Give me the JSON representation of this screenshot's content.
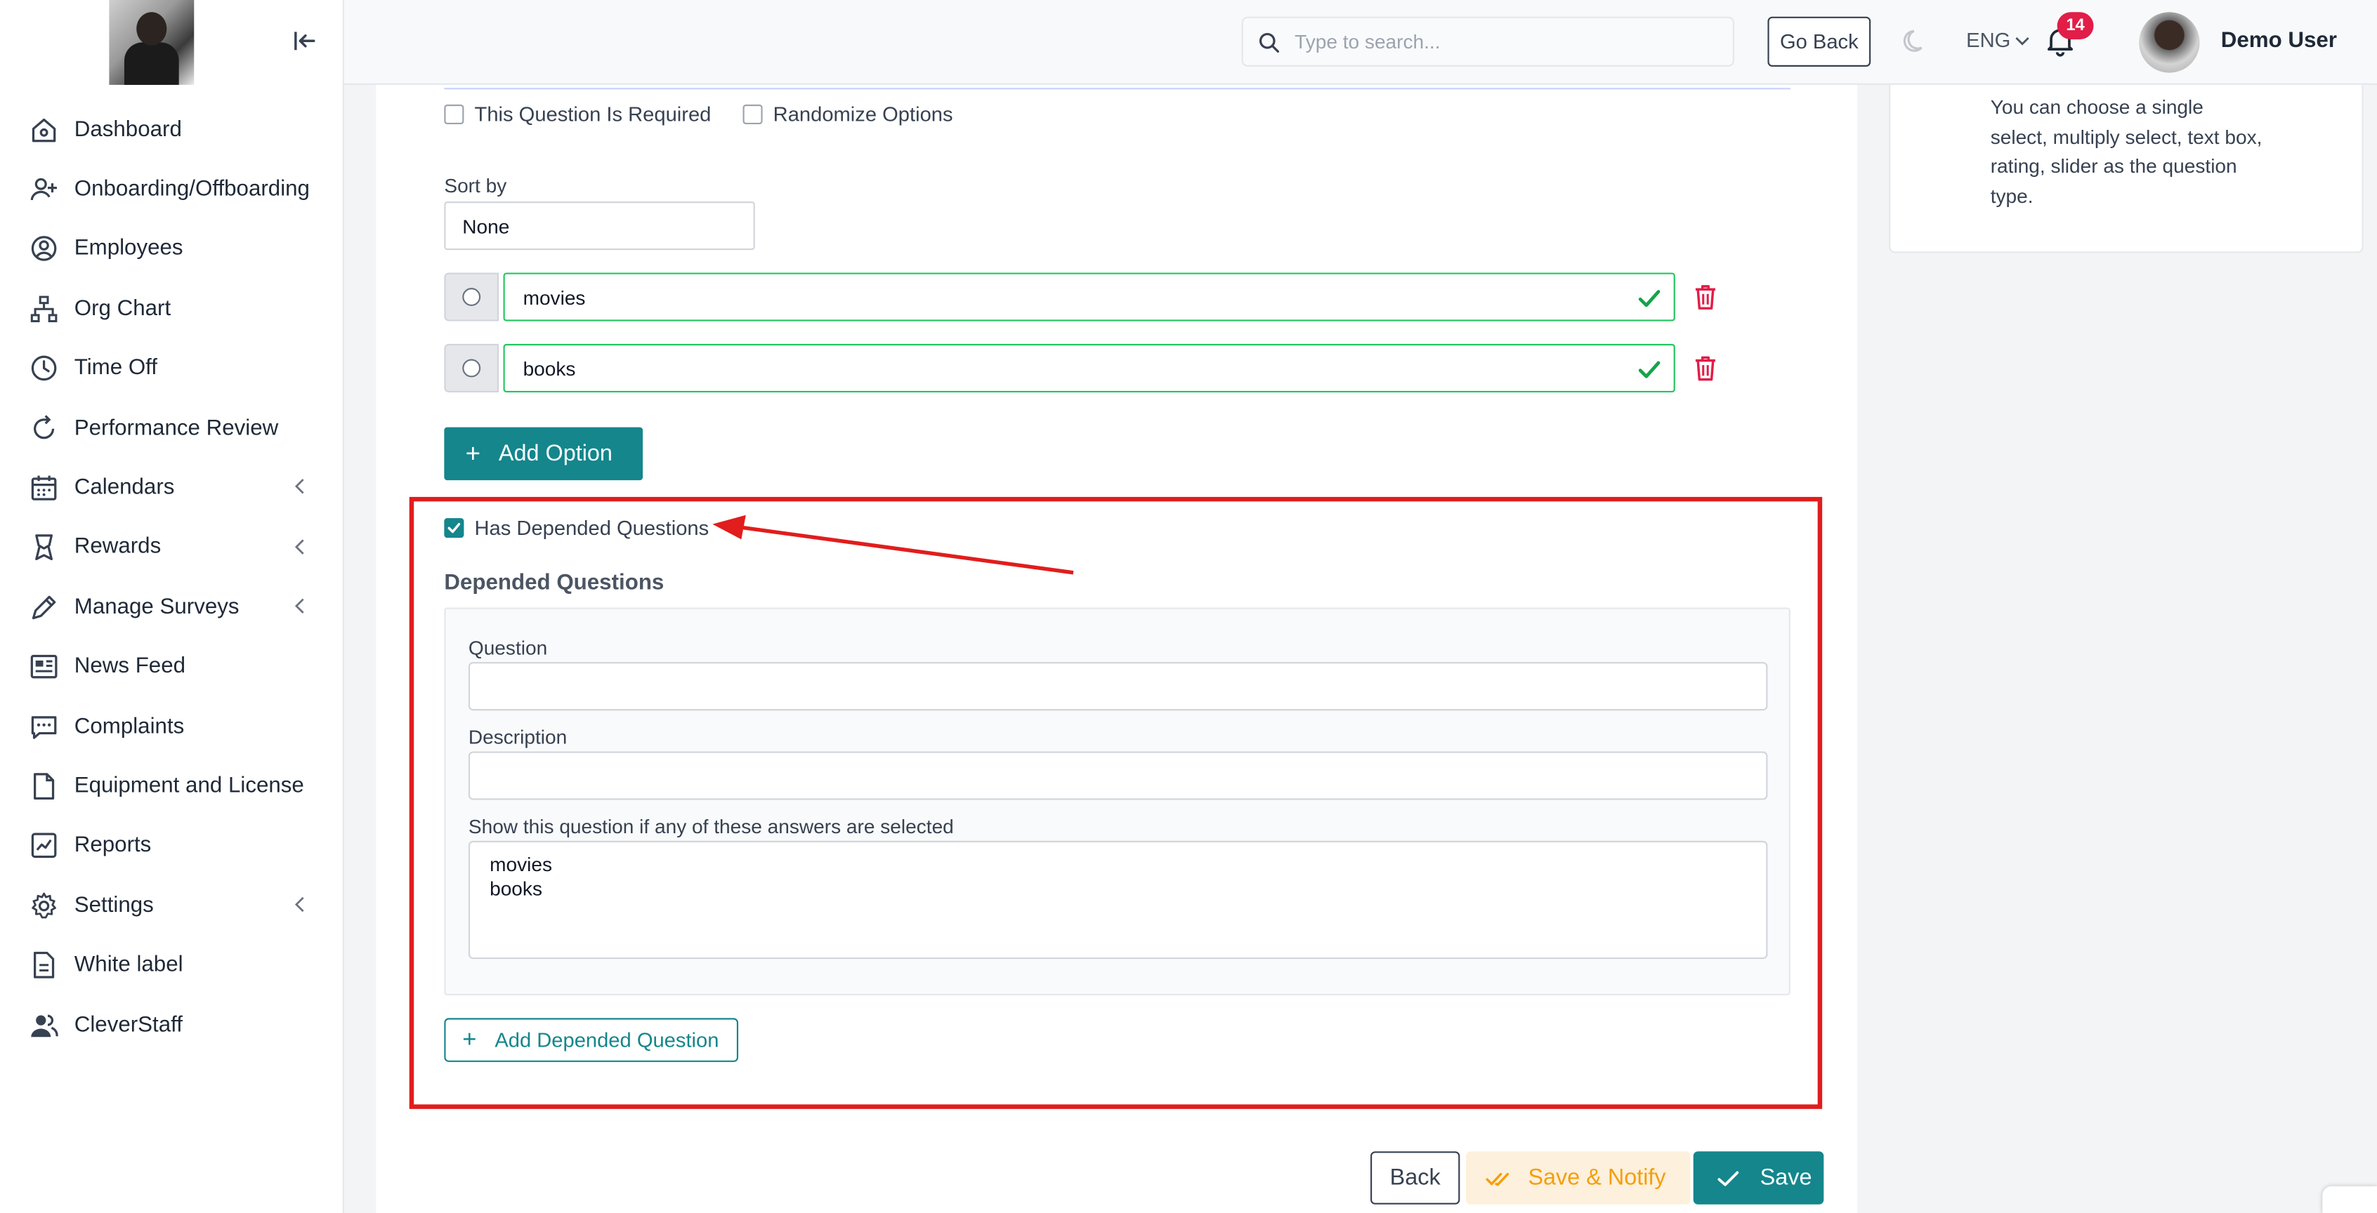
{
  "header": {
    "search_placeholder": "Type to search...",
    "go_back_label": "Go Back",
    "language": "ENG",
    "notification_count": "14",
    "user_name": "Demo User"
  },
  "sidebar": {
    "items": [
      {
        "label": "Dashboard",
        "icon": "home-icon",
        "has_chevron": false
      },
      {
        "label": "Onboarding/Offboarding",
        "icon": "user-plus-icon",
        "has_chevron": false
      },
      {
        "label": "Employees",
        "icon": "user-circle-icon",
        "has_chevron": false
      },
      {
        "label": "Org Chart",
        "icon": "org-chart-icon",
        "has_chevron": false
      },
      {
        "label": "Time Off",
        "icon": "clock-icon",
        "has_chevron": false
      },
      {
        "label": "Performance Review",
        "icon": "refresh-icon",
        "has_chevron": false
      },
      {
        "label": "Calendars",
        "icon": "calendar-icon",
        "has_chevron": true
      },
      {
        "label": "Rewards",
        "icon": "award-icon",
        "has_chevron": true
      },
      {
        "label": "Manage Surveys",
        "icon": "pen-icon",
        "has_chevron": true
      },
      {
        "label": "News Feed",
        "icon": "newspaper-icon",
        "has_chevron": false
      },
      {
        "label": "Complaints",
        "icon": "message-icon",
        "has_chevron": false
      },
      {
        "label": "Equipment and License",
        "icon": "file-icon",
        "has_chevron": false
      },
      {
        "label": "Reports",
        "icon": "chart-icon",
        "has_chevron": false
      },
      {
        "label": "Settings",
        "icon": "gear-icon",
        "has_chevron": true
      },
      {
        "label": "White label",
        "icon": "document-icon",
        "has_chevron": false
      },
      {
        "label": "CleverStaff",
        "icon": "users-icon",
        "has_chevron": false
      }
    ]
  },
  "question": {
    "required_label": "This Question Is Required",
    "randomize_label": "Randomize Options",
    "sort_by_label": "Sort by",
    "sort_by_value": "None",
    "options": [
      "movies",
      "books"
    ],
    "add_option_label": "Add Option"
  },
  "depended": {
    "has_depended_label": "Has Depended Questions",
    "has_depended_checked": true,
    "section_title": "Depended Questions",
    "question_label": "Question",
    "question_value": "",
    "description_label": "Description",
    "description_value": "",
    "show_if_label": "Show this question if any of these answers are selected",
    "answers": [
      "movies",
      "books"
    ],
    "add_depended_label": "Add Depended Question"
  },
  "footer": {
    "back_label": "Back",
    "save_notify_label": "Save & Notify",
    "save_label": "Save"
  },
  "tip": {
    "text": "You can choose a single select, multiply select, text box, rating, slider as the question type."
  },
  "colors": {
    "primary": "#14868c",
    "highlight_border": "#e11d1d",
    "success": "#22c55e",
    "danger": "#e11d48",
    "warning": "#f59e0b"
  }
}
